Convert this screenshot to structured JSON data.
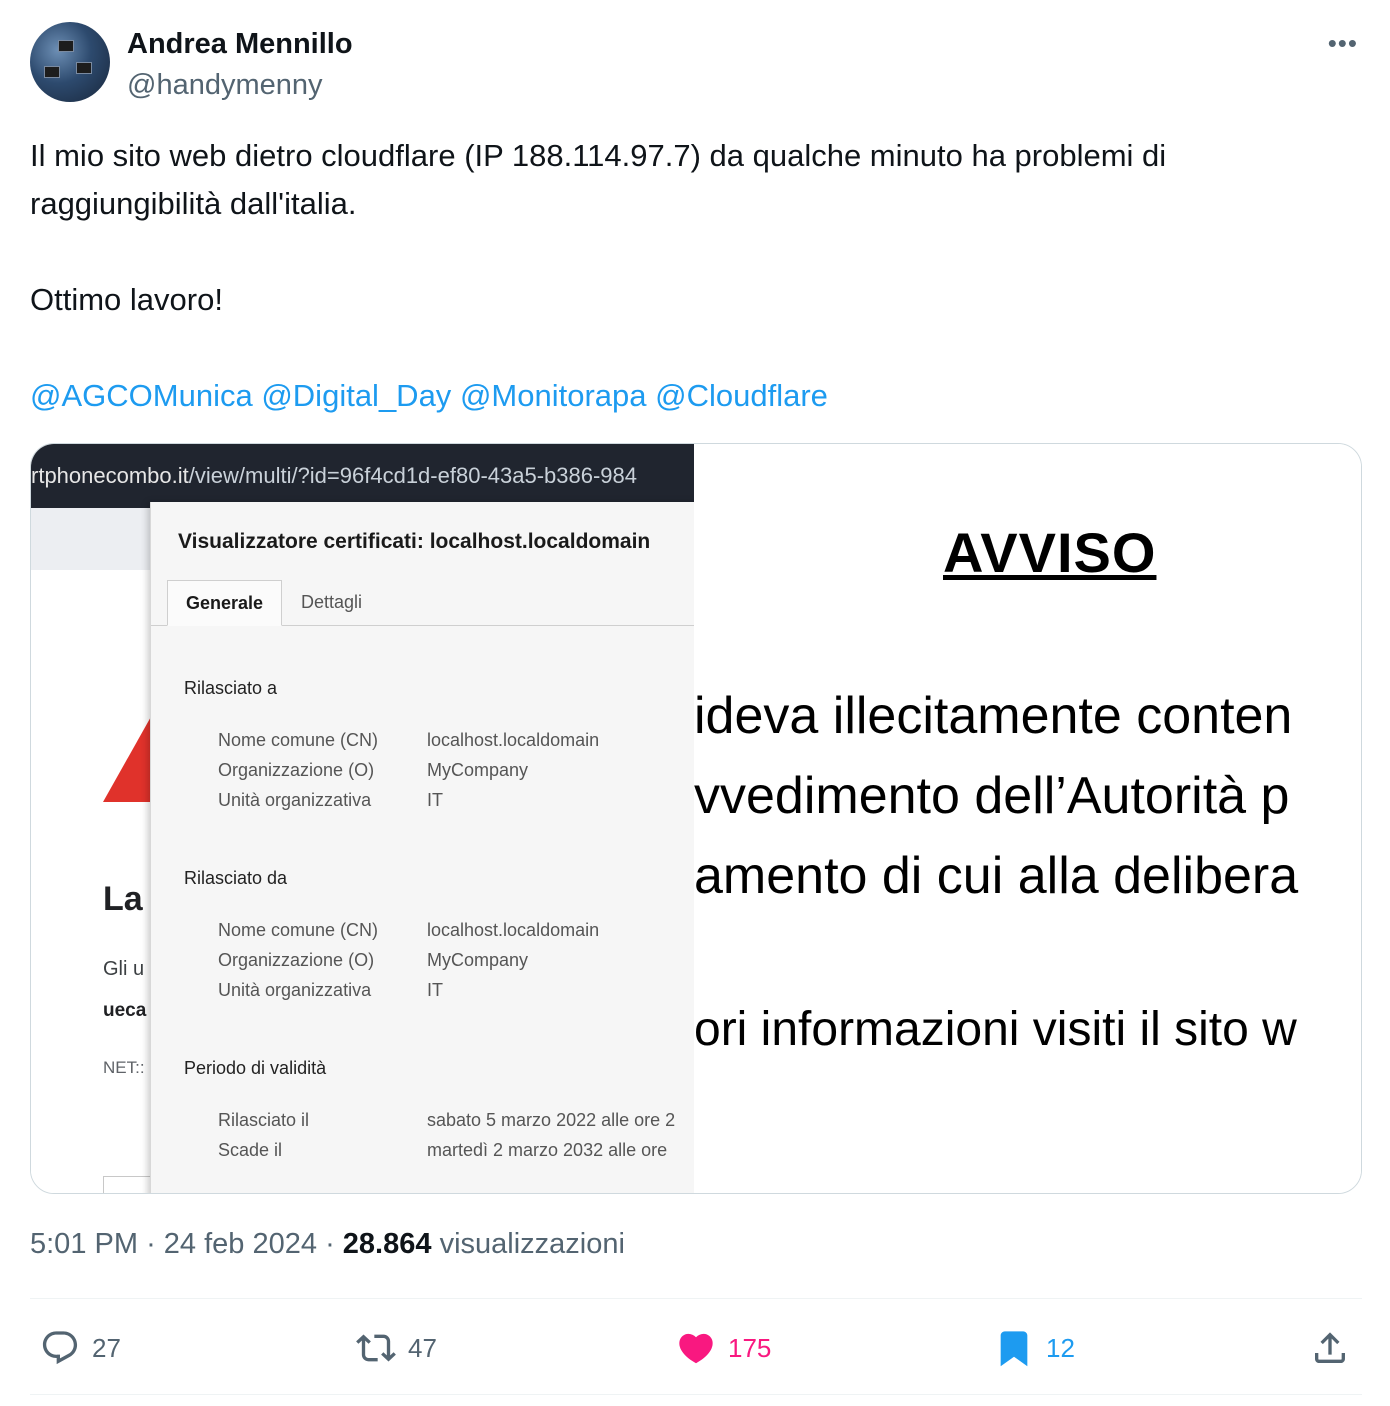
{
  "author": {
    "name": "Andrea Mennillo",
    "handle": "@handymenny",
    "more_icon": "more-icon"
  },
  "tweet": {
    "line1": "Il mio sito web dietro cloudflare (IP 188.114.97.7) da qualche minuto ha problemi di raggiungibilità dall'italia.",
    "line2": "Ottimo lavoro!",
    "mentions": [
      "@AGCOMunica",
      "@Digital_Day",
      "@Monitorapa",
      "@Cloudflare"
    ]
  },
  "media": {
    "url_host": "rtphonecombo.it",
    "url_path": "/view/multi/?id=96f4cd1d-ef80-43a5-b386-984",
    "background": {
      "title": "La",
      "line1": "Gli u",
      "line2": "ueca",
      "line3": "NET::"
    },
    "cert_dialog": {
      "title": "Visualizzatore certificati: localhost.localdomain",
      "tabs": [
        "Generale",
        "Dettagli"
      ],
      "issued_to_heading": "Rilasciato a",
      "issued_by_heading": "Rilasciato da",
      "validity_heading": "Periodo di validità",
      "label_cn": "Nome comune (CN)",
      "label_o": "Organizzazione (O)",
      "label_ou": "Unità organizzativa",
      "issued_to": {
        "cn": "localhost.localdomain",
        "o": "MyCompany",
        "ou": "IT"
      },
      "issued_by": {
        "cn": "localhost.localdomain",
        "o": "MyCompany",
        "ou": "IT"
      },
      "label_issued_on": "Rilasciato il",
      "label_expires": "Scade il",
      "issued_on": "sabato 5 marzo 2022 alle ore 2",
      "expires": "martedì 2 marzo 2032 alle ore"
    },
    "notice": {
      "title": "AVVISO",
      "line1": "ideva illecitamente conten",
      "line2": "vvedimento dell’Autorità p",
      "line3": "amento di cui alla delibera",
      "line4": "ori informazioni visiti il sito w"
    }
  },
  "meta": {
    "time": "5:01 PM",
    "sep": "·",
    "date": "24 feb 2024",
    "views": "28.864",
    "views_label": "visualizzazioni"
  },
  "actions": {
    "replies": "27",
    "retweets": "47",
    "likes": "175",
    "bookmarks": "12"
  },
  "colors": {
    "link": "#1d9bf0",
    "like": "#f91880",
    "secondary_text": "#536471"
  }
}
